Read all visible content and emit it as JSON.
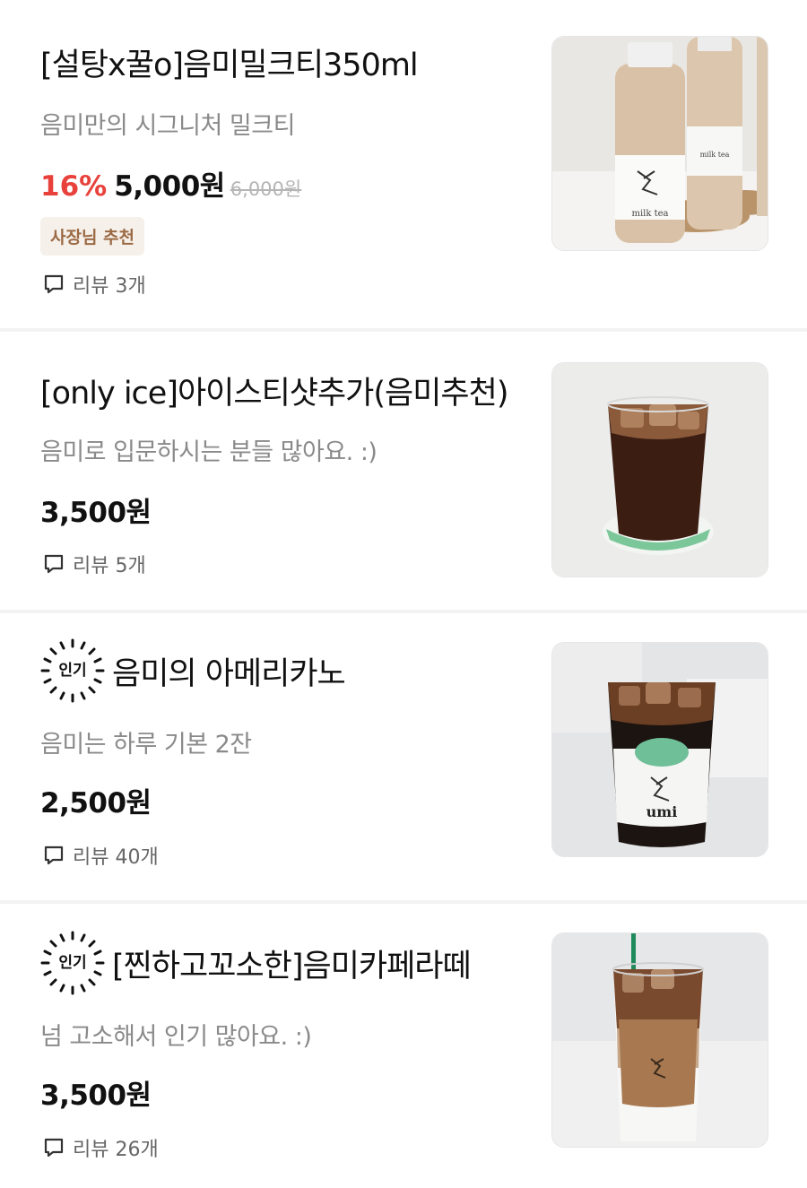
{
  "items": [
    {
      "title": "[설탕x꿀o]음미밀크티350ml",
      "description": "음미만의 시그니처 밀크티",
      "discount": "16%",
      "price": "5,000원",
      "original_price": "6,000원",
      "badge": "사장님 추천",
      "reviews": "리뷰 3개",
      "image_labels": [
        "milk tea",
        "milk tea"
      ]
    },
    {
      "title": "[only ice]아이스티샷추가(음미추천)",
      "description": "음미로 입문하시는 분들 많아요. :)",
      "price": "3,500원",
      "reviews": "리뷰 5개"
    },
    {
      "popular_label": "인기",
      "title": "음미의 아메리카노",
      "description": "음미는 하루 기본 2잔",
      "price": "2,500원",
      "reviews": "리뷰 40개",
      "image_label": "umi"
    },
    {
      "popular_label": "인기",
      "title": "[찐하고꼬소한]음미카페라떼",
      "description": "넘 고소해서 인기 많아요. :)",
      "price": "3,500원",
      "reviews": "리뷰 26개"
    }
  ],
  "colors": {
    "discount": "#e8413b",
    "badge_bg": "#f6f0ea",
    "badge_text": "#9b6a45",
    "muted": "#8a8a8a"
  },
  "icons": {
    "review": "chat-bubble-icon",
    "popular": "sunburst-badge-icon"
  }
}
